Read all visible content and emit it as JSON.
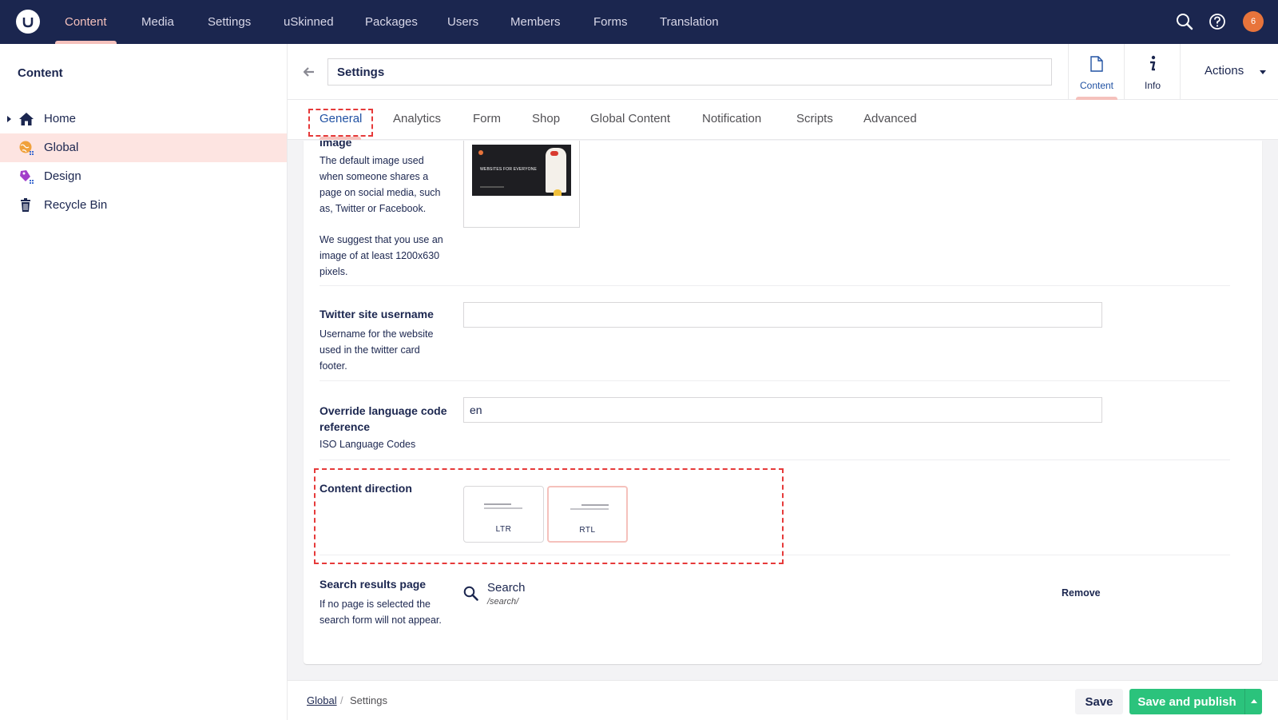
{
  "topnav": {
    "items": [
      "Content",
      "Media",
      "Settings",
      "uSkinned",
      "Packages",
      "Users",
      "Members",
      "Forms",
      "Translation"
    ],
    "avatar_initial": "6"
  },
  "sidebar": {
    "title": "Content",
    "items": [
      {
        "label": "Home",
        "icon": "home-icon"
      },
      {
        "label": "Global",
        "icon": "globe-icon"
      },
      {
        "label": "Design",
        "icon": "design-icon"
      },
      {
        "label": "Recycle Bin",
        "icon": "trash-icon"
      }
    ]
  },
  "editor": {
    "name_value": "Settings",
    "apps": [
      {
        "label": "Content",
        "icon": "document-icon"
      },
      {
        "label": "Info",
        "icon": "info-icon"
      }
    ],
    "actions_label": "Actions"
  },
  "subtabs": [
    "General",
    "Analytics",
    "Form",
    "Shop",
    "Global Content",
    "Notification",
    "Scripts",
    "Advanced"
  ],
  "properties": {
    "image": {
      "title": "image",
      "desc1": "The default image used when someone shares a page on social media, such as, Twitter or Facebook.",
      "desc2": "We suggest that you use an image of at least 1200x630 pixels.",
      "thumb_text": "WEBSITES FOR EVERYONE"
    },
    "twitter": {
      "title": "Twitter site username",
      "desc": "Username for the website used in the twitter card footer.",
      "value": ""
    },
    "language": {
      "title": "Override language code reference",
      "desc": "ISO Language Codes",
      "value": "en"
    },
    "direction": {
      "title": "Content direction",
      "options": [
        "LTR",
        "RTL"
      ],
      "selected": "RTL"
    },
    "search": {
      "title": "Search results page",
      "desc": "If no page is selected the search form will not appear.",
      "picked_name": "Search",
      "picked_url": "/search/",
      "remove_label": "Remove"
    }
  },
  "footer": {
    "breadcrumb_link": "Global",
    "breadcrumb_sep": "/",
    "breadcrumb_current": "Settings",
    "save_label": "Save",
    "publish_label": "Save and publish"
  },
  "colors": {
    "nav_bg": "#1b264f",
    "accent_pink": "#f5c1bc",
    "publish_green": "#2bc37c",
    "annotation_red": "#e63a3a"
  }
}
